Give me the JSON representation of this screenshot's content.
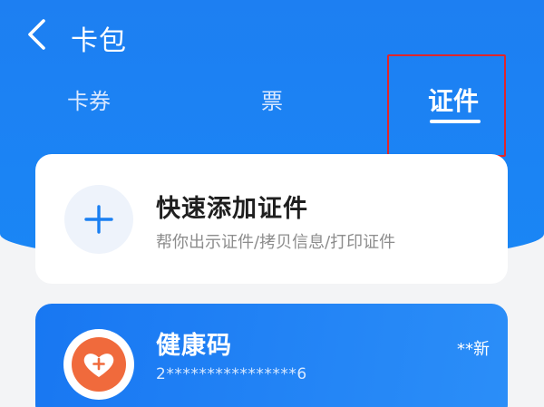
{
  "header": {
    "title": "卡包",
    "back_icon": "chevron-left-icon"
  },
  "tabs": [
    {
      "label": "卡券",
      "active": false
    },
    {
      "label": "票",
      "active": false
    },
    {
      "label": "证件",
      "active": true
    }
  ],
  "quick_add": {
    "title": "快速添加证件",
    "subtitle": "帮你出示证件/拷贝信息/打印证件",
    "icon": "plus-icon"
  },
  "health_code": {
    "title": "健康码",
    "number": "2****************6",
    "owner": "**新",
    "icon": "heart-plus-icon"
  },
  "colors": {
    "brand_blue": "#1a80f4",
    "highlight_red": "#e0252a",
    "icon_orange": "#f06a3c"
  }
}
